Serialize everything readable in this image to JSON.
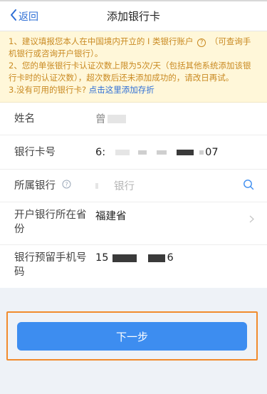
{
  "nav": {
    "back_label": "返回",
    "title": "添加银行卡"
  },
  "notice": {
    "line1a": "1、建议填报您本人在中国境内开立的 I 类银行账户",
    "line1b": "（可查询手机银行或咨询开户银行）。",
    "line2": "2、您的单张银行卡认证次数上限为5次/天（包括其他系统添加该银行卡时的认证次数），超次数后还未添加成功的，请改日再试。",
    "line3_prefix": "3.没有可用的银行卡?",
    "line3_link": "点击这里添加存折"
  },
  "form": {
    "name_label": "姓名",
    "name_value": "曾",
    "card_label": "银行卡号",
    "card_value_start": "6:",
    "card_value_end": "07",
    "bank_label": "所属银行",
    "bank_placeholder": "银行",
    "province_label": "开户银行所在省份",
    "province_value": "福建省",
    "phone_label": "银行预留手机号码",
    "phone_value_start": "15",
    "phone_value_end": "6"
  },
  "next_button": "下一步",
  "icons": {
    "back": "chevron-left-icon",
    "help": "question-circle-icon",
    "search": "search-icon",
    "arrow": "chevron-right-icon"
  },
  "colors": {
    "accent": "#3d8df0",
    "link": "#2f6fd6",
    "notice_text": "#c98a22",
    "highlight_border": "#f18b2c"
  }
}
